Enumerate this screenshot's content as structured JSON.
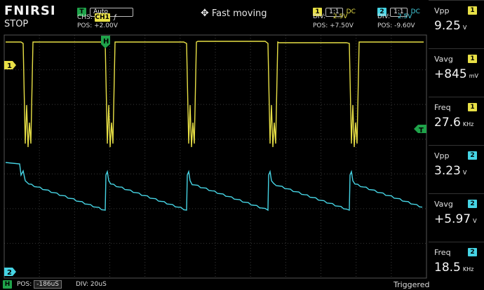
{
  "header": {
    "brand": "FNIRSI",
    "run_state": "STOP",
    "trigger_badge": "T",
    "trigger_mode": "Auto",
    "chs_label": "CHS:",
    "chs_value": "CH1",
    "pos_label": "POS:",
    "pos_value": "+2.00V",
    "center_text": "Fast moving"
  },
  "ch1": {
    "badge": "1",
    "probe": "1:1",
    "coupling": "DC",
    "div_label": "DIV:",
    "div_value": "2.5V",
    "pos_label": "POS:",
    "pos_value": "+7.50V"
  },
  "ch2": {
    "badge": "2",
    "probe": "1:1",
    "coupling": "DC",
    "div_label": "DIV:",
    "div_value": "2.5V",
    "pos_label": "POS:",
    "pos_value": "-9.60V"
  },
  "measurements": [
    {
      "label": "Vpp",
      "channel": "1",
      "value": "9.25",
      "unit": "V",
      "color": "#e8e046"
    },
    {
      "label": "Vavg",
      "channel": "1",
      "value": "+845",
      "unit": "mV",
      "color": "#e8e046"
    },
    {
      "label": "Freq",
      "channel": "1",
      "value": "27.6",
      "unit": "KHz",
      "color": "#e8e046"
    },
    {
      "label": "Vpp",
      "channel": "2",
      "value": "3.23",
      "unit": "V",
      "color": "#46d4e4"
    },
    {
      "label": "Vavg",
      "channel": "2",
      "value": "+5.97",
      "unit": "V",
      "color": "#46d4e4"
    },
    {
      "label": "Freq",
      "channel": "2",
      "value": "18.5",
      "unit": "KHz",
      "color": "#46d4e4"
    }
  ],
  "markers": {
    "ch1": "1",
    "ch2": "2",
    "trigger": "T",
    "h_pos": "H"
  },
  "footer": {
    "h_badge": "H",
    "pos_label": "POS:",
    "pos_value": "-186uS",
    "div_label": "DIV:",
    "div_value": "20uS",
    "status": "Triggered"
  },
  "colors": {
    "ch1": "#e8e046",
    "ch2": "#46d4e4",
    "trigger": "#1fa34a",
    "grid": "#3a3a3a"
  }
}
